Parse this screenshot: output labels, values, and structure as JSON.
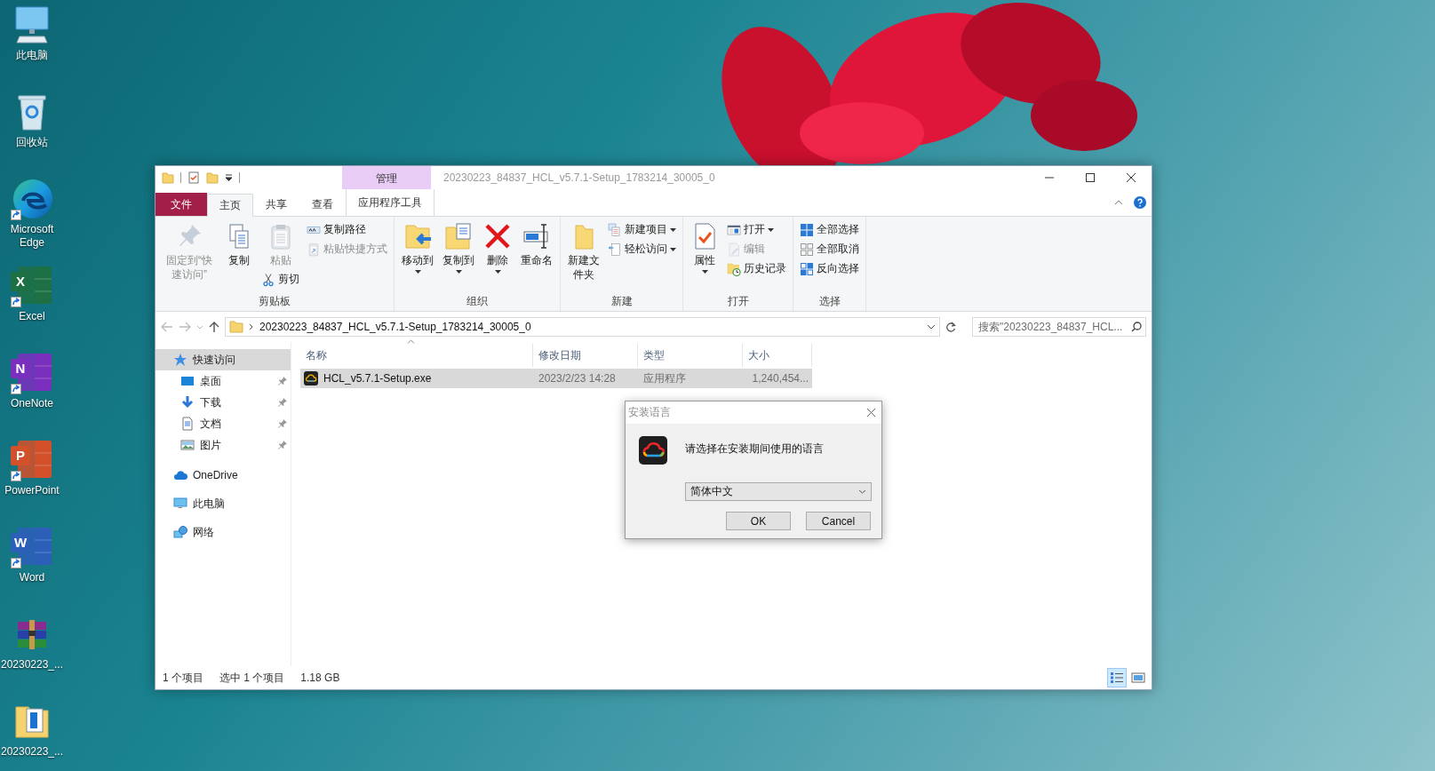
{
  "desktop": {
    "icons": [
      {
        "label": "此电脑",
        "shortcut": false
      },
      {
        "label": "回收站",
        "shortcut": false
      },
      {
        "label": "Microsoft Edge",
        "shortcut": true
      },
      {
        "label": "Excel",
        "letter": "X",
        "shortcut": true
      },
      {
        "label": "OneNote",
        "letter": "N",
        "shortcut": true
      },
      {
        "label": "PowerPoint",
        "letter": "P",
        "shortcut": true
      },
      {
        "label": "Word",
        "letter": "W",
        "shortcut": true
      },
      {
        "label": "20230223_...",
        "shortcut": false
      },
      {
        "label": "20230223_...",
        "shortcut": false
      }
    ]
  },
  "explorer": {
    "title": "20230223_84837_HCL_v5.7.1-Setup_1783214_30005_0",
    "context_tab_header": "管理",
    "tabs": [
      {
        "label": "文件",
        "kind": "file",
        "selected": false
      },
      {
        "label": "主页",
        "kind": "normal",
        "selected": true
      },
      {
        "label": "共享",
        "kind": "normal",
        "selected": false
      },
      {
        "label": "查看",
        "kind": "normal",
        "selected": false
      },
      {
        "label": "应用程序工具",
        "kind": "context",
        "selected": false
      }
    ],
    "ribbon": {
      "groups": [
        {
          "label": "剪贴板",
          "columns": [
            [
              {
                "label": "固定到“快速访问”",
                "kind": "large",
                "disabled": true,
                "dropdown": false
              }
            ],
            [
              {
                "label": "复制",
                "kind": "large",
                "disabled": false,
                "dropdown": false
              }
            ],
            [
              {
                "label": "粘贴",
                "kind": "large",
                "disabled": true,
                "dropdown": false
              },
              {
                "label": "剪切",
                "kind": "small",
                "disabled": false,
                "dropdown": false
              }
            ],
            [
              {
                "label": "复制路径",
                "kind": "small",
                "disabled": false,
                "dropdown": false
              },
              {
                "label": "粘贴快捷方式",
                "kind": "small",
                "disabled": true,
                "dropdown": false
              }
            ]
          ]
        },
        {
          "label": "组织",
          "columns": [
            [
              {
                "label": "移动到",
                "kind": "large",
                "disabled": false,
                "dropdown": true
              }
            ],
            [
              {
                "label": "复制到",
                "kind": "large",
                "disabled": false,
                "dropdown": true
              }
            ],
            [
              {
                "label": "删除",
                "kind": "large",
                "disabled": false,
                "dropdown": true
              }
            ],
            [
              {
                "label": "重命名",
                "kind": "large",
                "disabled": false,
                "dropdown": false
              }
            ]
          ]
        },
        {
          "label": "新建",
          "columns": [
            [
              {
                "label": "新建文件夹",
                "kind": "large",
                "disabled": false,
                "dropdown": false
              }
            ],
            [
              {
                "label": "新建项目",
                "kind": "small",
                "disabled": false,
                "dropdown": true
              },
              {
                "label": "轻松访问",
                "kind": "small",
                "disabled": false,
                "dropdown": true
              }
            ]
          ]
        },
        {
          "label": "打开",
          "columns": [
            [
              {
                "label": "属性",
                "kind": "large",
                "disabled": false,
                "dropdown": true
              }
            ],
            [
              {
                "label": "打开",
                "kind": "small",
                "disabled": false,
                "dropdown": true
              },
              {
                "label": "编辑",
                "kind": "small",
                "disabled": true,
                "dropdown": false
              },
              {
                "label": "历史记录",
                "kind": "small",
                "disabled": false,
                "dropdown": false
              }
            ]
          ]
        },
        {
          "label": "选择",
          "columns": [
            [
              {
                "label": "全部选择",
                "kind": "small",
                "disabled": false,
                "dropdown": false
              },
              {
                "label": "全部取消",
                "kind": "small",
                "disabled": false,
                "dropdown": false
              },
              {
                "label": "反向选择",
                "kind": "small",
                "disabled": false,
                "dropdown": false
              }
            ]
          ]
        }
      ]
    },
    "address": {
      "path": "20230223_84837_HCL_v5.7.1-Setup_1783214_30005_0"
    },
    "search": {
      "placeholder": "搜索\"20230223_84837_HCL..."
    },
    "navigation": {
      "items": [
        {
          "label": "快速访问",
          "selected": true,
          "children": [
            {
              "label": "桌面",
              "pinned": true
            },
            {
              "label": "下载",
              "pinned": true
            },
            {
              "label": "文档",
              "pinned": true
            },
            {
              "label": "图片",
              "pinned": true
            }
          ]
        },
        {
          "label": "OneDrive",
          "selected": false
        },
        {
          "label": "此电脑",
          "selected": false
        },
        {
          "label": "网络",
          "selected": false
        }
      ]
    },
    "file_list": {
      "columns": [
        {
          "label": "名称",
          "sorted": true
        },
        {
          "label": "修改日期",
          "sorted": false
        },
        {
          "label": "类型",
          "sorted": false
        },
        {
          "label": "大小",
          "sorted": false
        }
      ],
      "rows": [
        {
          "cells": [
            "HCL_v5.7.1-Setup.exe",
            "2023/2/23 14:28",
            "应用程序",
            "1,240,454..."
          ],
          "selected": true
        }
      ]
    },
    "status_bar": {
      "item_count": "1 个项目",
      "selection": "选中 1 个项目",
      "size": "1.18 GB",
      "views": [
        {
          "selected": true
        },
        {
          "selected": false
        }
      ]
    }
  },
  "dialog": {
    "title": "安装语言",
    "message": "请选择在安装期间使用的语言",
    "language": "简体中文",
    "buttons": [
      "OK",
      "Cancel"
    ]
  }
}
